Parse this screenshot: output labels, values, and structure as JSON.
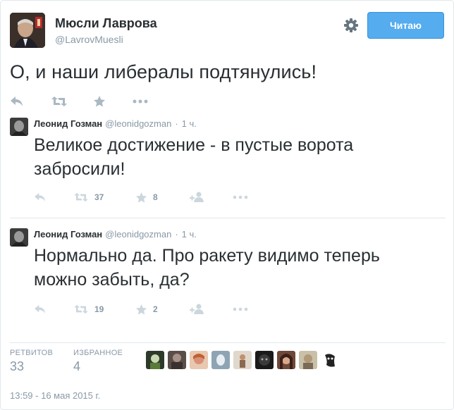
{
  "author": {
    "name": "Мюсли Лаврова",
    "handle": "@LavrovMuesli"
  },
  "follow_button": {
    "label": "Читаю"
  },
  "tweet": {
    "text": "О, и наши либералы подтянулись!"
  },
  "quotes": [
    {
      "name": "Леонид Гозман",
      "handle": "@leonidgozman",
      "time": "1 ч.",
      "text_line1": "Великое достижение - в пустые ворота",
      "text_line2": "забросили!",
      "retweets": "37",
      "favorites": "8"
    },
    {
      "name": "Леонид Гозман",
      "handle": "@leonidgozman",
      "time": "1 ч.",
      "text_line1": "Нормально да. Про ракету видимо теперь",
      "text_line2": "можно забыть, да?",
      "retweets": "19",
      "favorites": "2"
    }
  ],
  "stats": {
    "retweets_label": "РЕТВИТОВ",
    "retweets_value": "33",
    "favorites_label": "ИЗБРАННОЕ",
    "favorites_value": "4"
  },
  "timestamp": "13:59 - 16 мая 2015 г.",
  "colors": {
    "accent": "#55acee",
    "muted": "#8899a6",
    "icon": "#aab8c2",
    "text": "#292f33"
  },
  "icons": [
    "gear-icon",
    "reply-icon",
    "retweet-icon",
    "favorite-icon",
    "more-icon",
    "follow-icon"
  ]
}
